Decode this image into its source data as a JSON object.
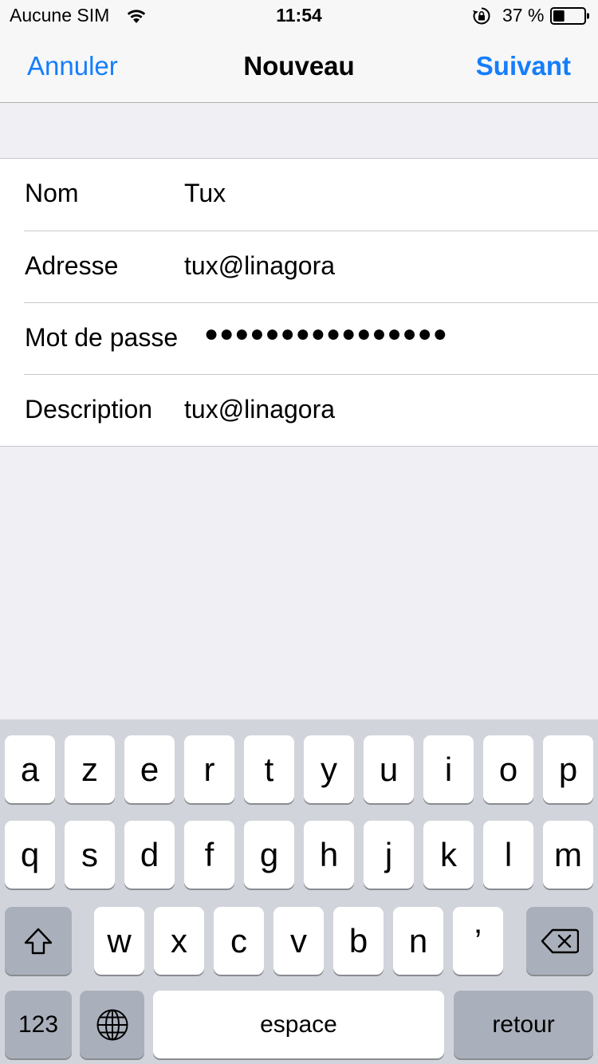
{
  "status_bar": {
    "carrier": "Aucune SIM",
    "time": "11:54",
    "battery_percent": "37 %",
    "battery_level": 0.37
  },
  "nav": {
    "cancel": "Annuler",
    "title": "Nouveau",
    "next": "Suivant",
    "accent_color": "#157efb"
  },
  "form": {
    "rows": [
      {
        "label": "Nom",
        "value": "Tux"
      },
      {
        "label": "Adresse",
        "value": "tux@linagora"
      },
      {
        "label": "Mot de passe",
        "value": "●●●●●●●●●●●●●●●●"
      },
      {
        "label": "Description",
        "value": "tux@linagora"
      }
    ]
  },
  "keyboard": {
    "row1": [
      "a",
      "z",
      "e",
      "r",
      "t",
      "y",
      "u",
      "i",
      "o",
      "p"
    ],
    "row2": [
      "q",
      "s",
      "d",
      "f",
      "g",
      "h",
      "j",
      "k",
      "l",
      "m"
    ],
    "row3": [
      "w",
      "x",
      "c",
      "v",
      "b",
      "n",
      "’"
    ],
    "numbers": "123",
    "space": "espace",
    "return": "retour",
    "icons": [
      "shift-icon",
      "backspace-icon",
      "globe-icon"
    ]
  }
}
